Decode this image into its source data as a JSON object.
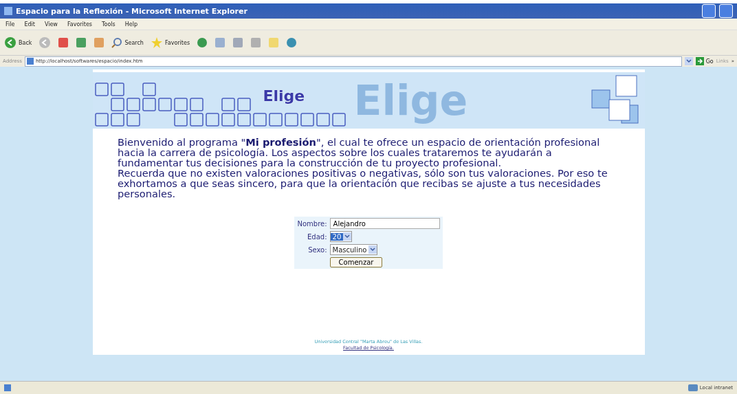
{
  "window": {
    "title": "Espacio para la Reflexión - Microsoft Internet Explorer"
  },
  "menu": [
    "File",
    "Edit",
    "View",
    "Favorites",
    "Tools",
    "Help"
  ],
  "toolbar": {
    "back": "Back",
    "search": "Search",
    "favorites": "Favorites"
  },
  "address_bar": {
    "label": "Address",
    "url": "http://localhost/softwares/espacio/index.htm",
    "go": "Go",
    "links": "Links",
    "more": "»"
  },
  "banner": {
    "logo": "Elige",
    "background_text": "Elige"
  },
  "intro": [
    "Bienvenido al programa \"**Mi profesión**\", el cual te ofrece un espacio de orientación profesional hacia la carrera de psicología. Los aspectos sobre los cuales trataremos te ayudarán a fundamentar tus decisiones para la construcción de tu proyecto profesional.",
    "Recuerda que no existen valoraciones positivas o negativas, sólo son tus valoraciones. Por eso te exhortamos a que seas sincero, para que la orientación que recibas se ajuste a tus necesidades personales."
  ],
  "form": {
    "fields": [
      {
        "kind": "text",
        "label": "Nombre:",
        "value": "Alejandro"
      },
      {
        "kind": "select",
        "label": "Edad:",
        "value": "20",
        "highlighted": true
      },
      {
        "kind": "select",
        "label": "Sexo:",
        "value": "Masculino",
        "highlighted": false
      }
    ],
    "submit": "Comenzar"
  },
  "footer": {
    "university": "Universidad Central \"Marta Abreu\" de Las Villas.",
    "faculty": "Facultad de Psicología."
  },
  "status_bar": {
    "zone": "Local intranet"
  }
}
